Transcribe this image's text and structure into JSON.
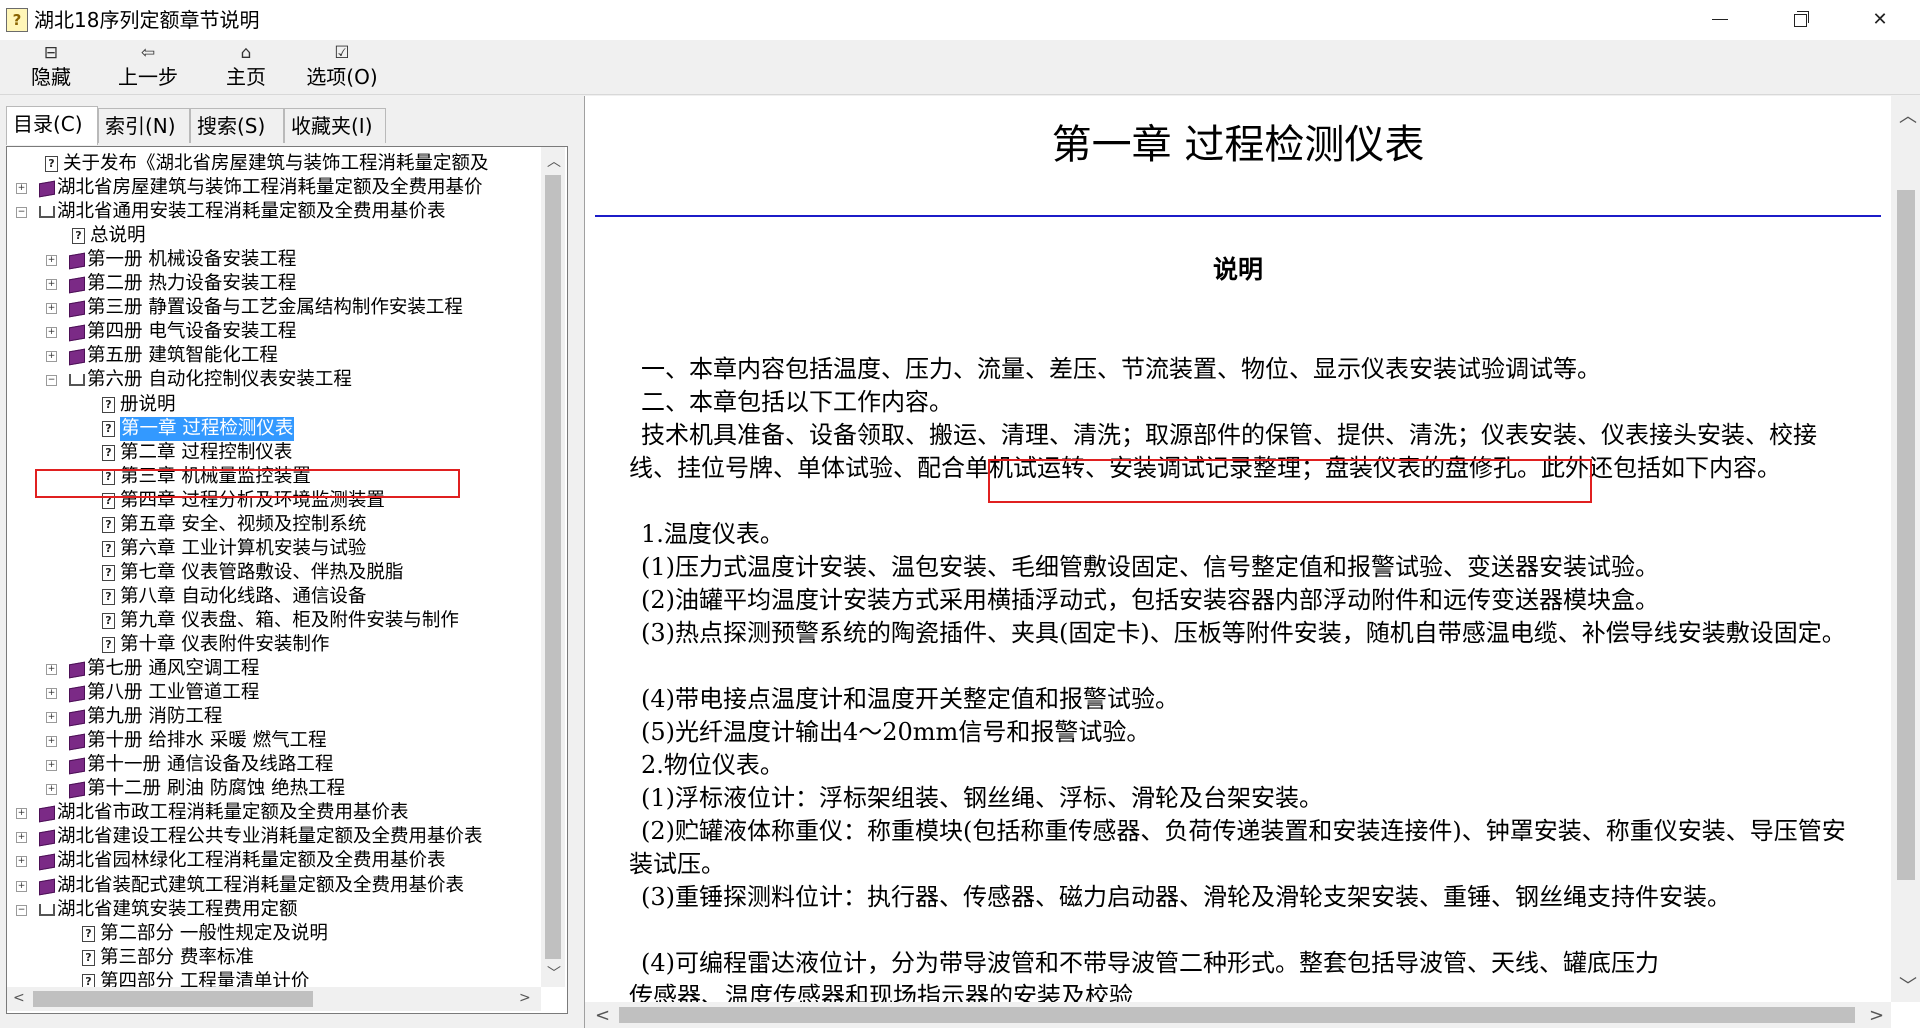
{
  "window": {
    "title": "湖北18序列定额章节说明",
    "icon_symbol": "?",
    "minimize_label": "",
    "close_label": "✕"
  },
  "toolbar": {
    "hide": {
      "icon": "⊟",
      "label": "隐藏"
    },
    "back": {
      "icon": "⇦",
      "label": "上一步"
    },
    "home": {
      "icon": "⌂",
      "label": "主页"
    },
    "options": {
      "icon": "☑",
      "label": "选项(O)"
    }
  },
  "tabs": [
    {
      "label": "目录(C)"
    },
    {
      "label": "索引(N)"
    },
    {
      "label": "搜索(S)"
    },
    {
      "label": "收藏夹(I)"
    }
  ],
  "tree": {
    "items": [
      {
        "label": "关于发布《湖北省房屋建筑与装饰工程消耗量定额及"
      },
      {
        "label": "湖北省房屋建筑与装饰工程消耗量定额及全费用基价"
      },
      {
        "label": "湖北省通用安装工程消耗量定额及全费用基价表"
      },
      {
        "label": "总说明"
      },
      {
        "label": "第一册  机械设备安装工程"
      },
      {
        "label": "第二册  热力设备安装工程"
      },
      {
        "label": "第三册  静置设备与工艺金属结构制作安装工程"
      },
      {
        "label": "第四册  电气设备安装工程"
      },
      {
        "label": "第五册  建筑智能化工程"
      },
      {
        "label": "第六册  自动化控制仪表安装工程"
      },
      {
        "label": "册说明"
      },
      {
        "label": "第一章  过程检测仪表"
      },
      {
        "label": "第二章  过程控制仪表"
      },
      {
        "label": "第三章  机械量监控装置"
      },
      {
        "label": "第四章  过程分析及环境监测装置"
      },
      {
        "label": "第五章  安全、视频及控制系统"
      },
      {
        "label": "第六章  工业计算机安装与试验"
      },
      {
        "label": "第七章  仪表管路敷设、伴热及脱脂"
      },
      {
        "label": "第八章  自动化线路、通信设备"
      },
      {
        "label": "第九章  仪表盘、箱、柜及附件安装与制作"
      },
      {
        "label": "第十章  仪表附件安装制作"
      },
      {
        "label": "第七册  通风空调工程"
      },
      {
        "label": "第八册  工业管道工程"
      },
      {
        "label": "第九册  消防工程"
      },
      {
        "label": "第十册  给排水  采暖  燃气工程"
      },
      {
        "label": "第十一册  通信设备及线路工程"
      },
      {
        "label": "第十二册  刷油  防腐蚀  绝热工程"
      },
      {
        "label": "湖北省市政工程消耗量定额及全费用基价表"
      },
      {
        "label": "湖北省建设工程公共专业消耗量定额及全费用基价表"
      },
      {
        "label": "湖北省园林绿化工程消耗量定额及全费用基价表"
      },
      {
        "label": "湖北省装配式建筑工程消耗量定额及全费用基价表"
      },
      {
        "label": "湖北省建筑安装工程费用定额"
      },
      {
        "label": "第二部分  一般性规定及说明"
      },
      {
        "label": "第三部分  费率标准"
      },
      {
        "label": "第四部分  工程量清单计价"
      }
    ]
  },
  "document": {
    "title": "第一章  过程检测仪表",
    "heading": "说明",
    "paragraphs": [
      "一、本章内容包括温度、压力、流量、差压、节流装置、物位、显示仪表安装试验调试等。",
      "二、本章包括以下工作内容。",
      "技术机具准备、设备领取、搬运、清理、清洗；取源部件的保管、提供、清洗；仪表安装、仪表接头安装、校接线、挂位号牌、单体试验、配合单机试运转、安装调试记录整理；盘装仪表的盘修孔。此外还包括如下内容。",
      "1.温度仪表。",
      "(1)压力式温度计安装、温包安装、毛细管敷设固定、信号整定值和报警试验、变送器安装试验。",
      "(2)油罐平均温度计安装方式采用横插浮动式，包括安装容器内部浮动附件和远传变送器模块盒。",
      "(3)热点探测预警系统的陶瓷插件、夹具(固定卡)、压板等附件安装，随机自带感温电缆、补偿导线安装敷设固定。",
      "(4)带电接点温度计和温度开关整定值和报警试验。",
      "(5)光纤温度计输出4～20mm信号和报警试验。",
      "2.物位仪表。",
      "(1)浮标液位计：浮标架组装、钢丝绳、浮标、滑轮及台架安装。",
      "(2)贮罐液体称重仪：称重模块(包括称重传感器、负荷传递装置和安装连接件)、钟罩安装、称重仪安装、导压管安装试压。",
      "(3)重锤探测料位计：执行器、传感器、磁力启动器、滑轮及滑轮支架安装、重锤、钢丝绳支持件安装。",
      "(4)可编程雷达液位计，分为带导波管和不带导波管二种形式。整套包括导波管、天线、罐底压力",
      "传感器、温度传感器和现场指示器的安装及校验"
    ]
  },
  "colors": {
    "selection": "#3399ff",
    "highlight_box": "#e02020",
    "rule": "#1c1cc8"
  }
}
